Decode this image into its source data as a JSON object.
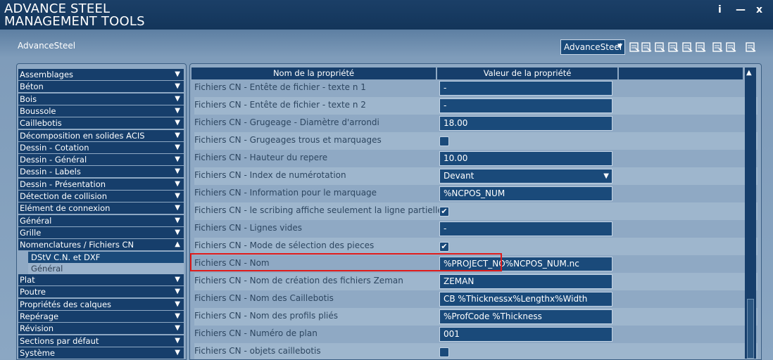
{
  "app": {
    "title_line1": "ADVANCE STEEL",
    "title_line2": "MANAGEMENT TOOLS",
    "info_label": "i",
    "minimize_label": "—",
    "close_label": "x",
    "project_label": "AdvanceSteel"
  },
  "toolbar": {
    "database_selected": "AdvanceSteel",
    "dropdown_arrow": "▼",
    "icons": [
      "table-add-icon",
      "table-import-icon",
      "table-export-icon",
      "table-edit-icon",
      "table-search-icon",
      "document-icon",
      "printer-icon",
      "printer-settings-icon",
      "export-file-icon"
    ]
  },
  "left_panel": {
    "categories": [
      {
        "label": "Assemblages",
        "arrow": "▼"
      },
      {
        "label": "Béton",
        "arrow": "▼"
      },
      {
        "label": "Bois",
        "arrow": "▼"
      },
      {
        "label": "Boussole",
        "arrow": "▼"
      },
      {
        "label": "Caillebotis",
        "arrow": "▼"
      },
      {
        "label": "Décomposition en solides ACIS",
        "arrow": "▼"
      },
      {
        "label": "Dessin - Cotation",
        "arrow": "▼"
      },
      {
        "label": "Dessin - Général",
        "arrow": "▼"
      },
      {
        "label": "Dessin - Labels",
        "arrow": "▼"
      },
      {
        "label": "Dessin - Présentation",
        "arrow": "▼"
      },
      {
        "label": "Détection de collision",
        "arrow": "▼"
      },
      {
        "label": "Elément de connexion",
        "arrow": "▼"
      },
      {
        "label": "Général",
        "arrow": "▼"
      },
      {
        "label": "Grille",
        "arrow": "▼"
      },
      {
        "label": "Nomenclatures / Fichiers CN",
        "arrow": "▲"
      }
    ],
    "subitems": [
      {
        "label": "DStV C.N. et DXF",
        "selected": true
      },
      {
        "label": "Général",
        "selected": false
      }
    ],
    "categories_after": [
      {
        "label": "Plat",
        "arrow": "▼"
      },
      {
        "label": "Poutre",
        "arrow": "▼"
      },
      {
        "label": "Propriétés des calques",
        "arrow": "▼"
      },
      {
        "label": "Repérage",
        "arrow": "▼"
      },
      {
        "label": "Révision",
        "arrow": "▼"
      },
      {
        "label": "Sections par défaut",
        "arrow": "▼"
      },
      {
        "label": "Système",
        "arrow": "▼"
      }
    ]
  },
  "table": {
    "col_name": "Nom de la propriété",
    "col_value": "Valeur de la propriété",
    "scroll_up": "▲",
    "rows": [
      {
        "name": "Fichiers CN - Entête de fichier - texte n 1",
        "type": "text",
        "value": "-"
      },
      {
        "name": "Fichiers CN - Entête de fichier - texte n 2",
        "type": "text",
        "value": "-"
      },
      {
        "name": "Fichiers CN - Grugeage - Diamètre d'arrondi",
        "type": "text",
        "value": "18.00"
      },
      {
        "name": "Fichiers CN - Grugeages trous et marquages",
        "type": "check",
        "checked": false
      },
      {
        "name": "Fichiers CN - Hauteur du repere",
        "type": "text",
        "value": "10.00"
      },
      {
        "name": "Fichiers CN - Index de numérotation",
        "type": "select",
        "value": "Devant"
      },
      {
        "name": "Fichiers CN - Information pour le marquage",
        "type": "text",
        "value": "%NCPOS_NUM"
      },
      {
        "name": "Fichiers CN - le scribing affiche seulement la ligne partielle",
        "type": "check",
        "checked": true
      },
      {
        "name": "Fichiers CN - Lignes vides",
        "type": "text",
        "value": "-"
      },
      {
        "name": "Fichiers CN - Mode de sélection des pieces",
        "type": "check",
        "checked": true
      },
      {
        "name": "Fichiers CN - Nom",
        "type": "text",
        "value": "%PROJECT_NO%NCPOS_NUM.nc"
      },
      {
        "name": "Fichiers CN - Nom de création des fichiers Zeman",
        "type": "text",
        "value": "ZEMAN"
      },
      {
        "name": "Fichiers CN - Nom des Caillebotis",
        "type": "text",
        "value": "CB %Thicknessx%Lengthx%Width"
      },
      {
        "name": "Fichiers CN - Nom des profils pliés",
        "type": "text",
        "value": "%ProfCode %Thickness"
      },
      {
        "name": "Fichiers CN - Numéro de plan",
        "type": "text",
        "value": "001"
      },
      {
        "name": "Fichiers CN - objets caillebotis",
        "type": "check",
        "checked": false
      }
    ]
  },
  "colors": {
    "titlebar": "#163e6b",
    "item_bg": "#163e6b",
    "highlight": "#e01b1b"
  }
}
